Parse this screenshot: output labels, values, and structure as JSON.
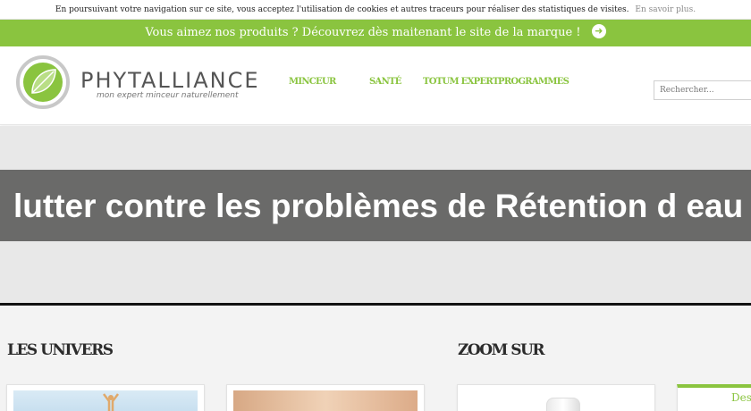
{
  "cookie_bar": {
    "text": "En poursuivant votre navigation sur ce site, vous acceptez l'utilisation de cookies et autres traceurs pour réaliser des statistiques de visites.",
    "more_link": "En savoir plus."
  },
  "promo_bar": {
    "text": "Vous aimez nos produits ? Découvrez dès maitenant le site de la marque !",
    "icon": "arrow-right-circle-icon"
  },
  "header": {
    "brand": "PHYTALLIANCE",
    "tagline": "mon expert minceur naturellement",
    "nav": {
      "minceur": "MINCEUR",
      "sante": "SANTÉ",
      "totum": "TOTUM EXPERT",
      "programmes": "PROGRAMMES"
    },
    "search": {
      "placeholder": "Rechercher...",
      "value": ""
    }
  },
  "hero": {
    "title": "lutter contre les problèmes de Rétention d eau"
  },
  "sections": {
    "univers": "LES UNIVERS",
    "zoom": "ZOOM SUR"
  },
  "cards": {
    "card4_label": "Des"
  },
  "colors": {
    "accent": "#8ac43f",
    "hero_band": "#6a6a69",
    "hero_bg": "#e8e8e8",
    "content_bg": "#f3f3f3"
  }
}
